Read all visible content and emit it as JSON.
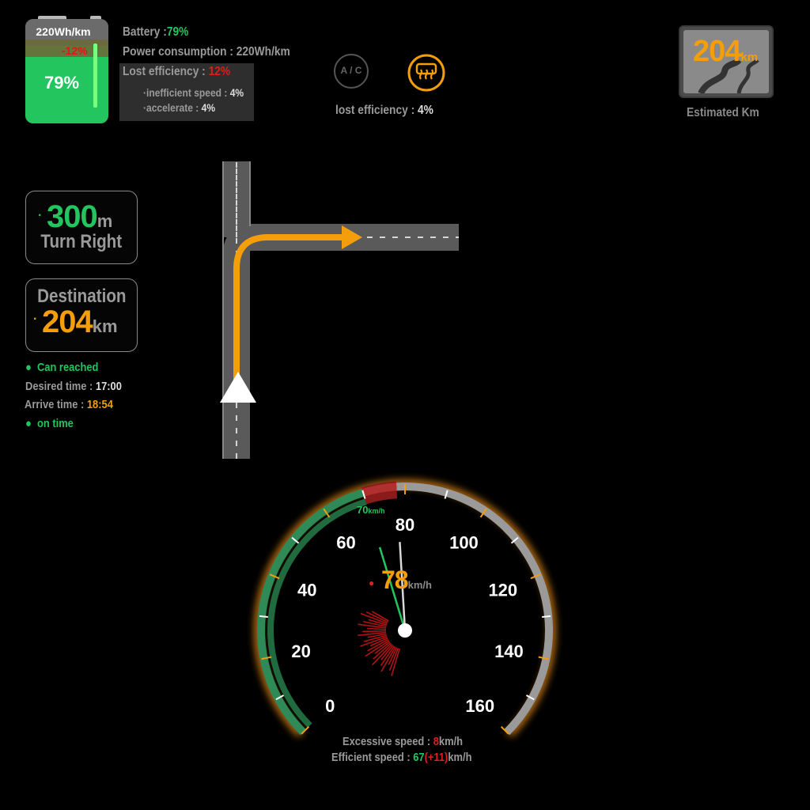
{
  "battery": {
    "consumption_label": "220Wh/km",
    "loss": "-12%",
    "percent": "79%",
    "level": 0.79
  },
  "stats": {
    "battery_label": "Battery :",
    "battery_value": "79%",
    "power_label": "Power consumption :",
    "power_value": "220Wh/km",
    "lost_label": "Lost efficiency :",
    "lost_value": "12%",
    "inefficient_label": "·inefficient speed :",
    "inefficient_value": "4%",
    "accelerate_label": "·accelerate :",
    "accelerate_value": "4%"
  },
  "climate": {
    "ac_label": "A / C",
    "lost_label": "lost efficiency :",
    "lost_value": "4%"
  },
  "estimate": {
    "value": "204",
    "unit": "km",
    "label": "Estimated Km"
  },
  "navigation": {
    "distance": "300",
    "distance_unit": "m",
    "instruction": "Turn Right"
  },
  "destination": {
    "title": "Destination",
    "distance": "204",
    "unit": "km"
  },
  "trip": {
    "reach_status": "Can reached",
    "desired_label": "Desired time :",
    "desired_value": "17:00",
    "arrive_label": "Arrive time :",
    "arrive_value": "18:54",
    "time_status": "on time"
  },
  "speedometer": {
    "speed": "78",
    "speed_value": 78,
    "unit": "km/h",
    "limit": "70",
    "limit_value": 70,
    "limit_unit": "km/h",
    "ticks": [
      0,
      20,
      40,
      60,
      80,
      100,
      120,
      140,
      160
    ],
    "max": 160,
    "excessive_label": "Excessive speed :",
    "excessive_value": "8",
    "efficient_label": "Efficient speed :",
    "efficient_value": "67",
    "efficient_delta": "(+11)",
    "speed_unit_suffix": "km/h",
    "colors": {
      "green": "#2e8b57",
      "red": "#8b1a1a",
      "gray": "#9a9a9a",
      "glow": "#ff9a1a"
    }
  },
  "colors": {
    "green": "#22c55e",
    "orange": "#f59e0b",
    "red": "#e11d1d",
    "road": "#5a5a5a"
  }
}
